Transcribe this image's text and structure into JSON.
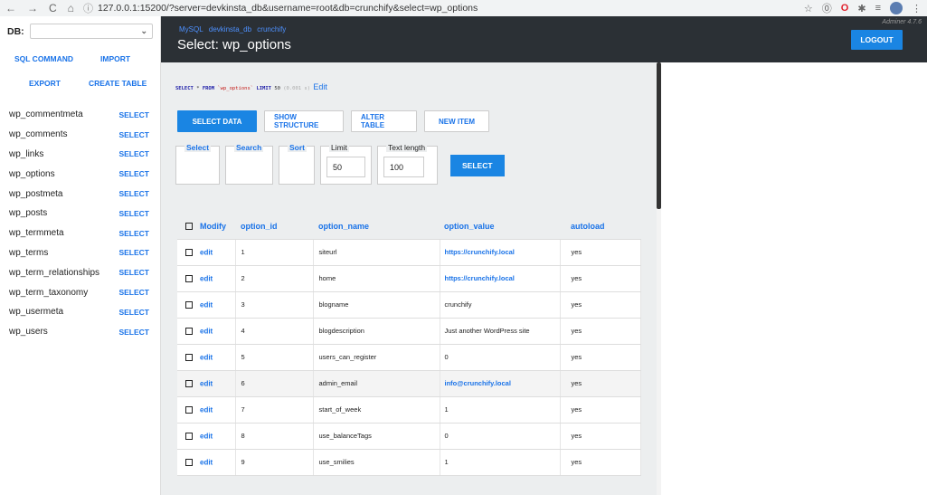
{
  "browser": {
    "url": "127.0.0.1:15200/?server=devkinsta_db&username=root&db=crunchify&select=wp_options"
  },
  "sidebar": {
    "db_label": "DB:",
    "db_value": "",
    "links": {
      "sql_command": "SQL COMMAND",
      "import": "IMPORT",
      "export": "EXPORT",
      "create_table": "CREATE TABLE"
    },
    "select_label": "SELECT",
    "tables": [
      "wp_commentmeta",
      "wp_comments",
      "wp_links",
      "wp_options",
      "wp_postmeta",
      "wp_posts",
      "wp_termmeta",
      "wp_terms",
      "wp_term_relationships",
      "wp_term_taxonomy",
      "wp_usermeta",
      "wp_users"
    ]
  },
  "header": {
    "breadcrumbs": [
      "MySQL",
      "devkinsta_db",
      "crunchify"
    ],
    "title": "Select: wp_options",
    "version": "Adminer 4.7.6",
    "logout": "LOGOUT"
  },
  "query": {
    "select_kw": "SELECT",
    "star": "*",
    "from_kw": "FROM",
    "table": "`wp_options`",
    "limit_kw": "LIMIT",
    "limit_val": "50",
    "time": "(0.001 s)",
    "edit": "Edit"
  },
  "actions": {
    "select_data": "SELECT DATA",
    "show_structure": "SHOW STRUCTURE",
    "alter_table": "ALTER TABLE",
    "new_item": "NEW ITEM"
  },
  "filters": {
    "select": "Select",
    "search": "Search",
    "sort": "Sort",
    "limit": "Limit",
    "limit_value": "50",
    "text_length": "Text length",
    "text_length_value": "100",
    "submit": "SELECT"
  },
  "table": {
    "headers": {
      "modify": "Modify",
      "option_id": "option_id",
      "option_name": "option_name",
      "option_value": "option_value",
      "autoload": "autoload"
    },
    "edit_label": "edit",
    "rows": [
      {
        "id": "1",
        "name": "siteurl",
        "value": "https://crunchify.local",
        "link": true,
        "autoload": "yes"
      },
      {
        "id": "2",
        "name": "home",
        "value": "https://crunchify.local",
        "link": true,
        "autoload": "yes"
      },
      {
        "id": "3",
        "name": "blogname",
        "value": "crunchify",
        "link": false,
        "autoload": "yes"
      },
      {
        "id": "4",
        "name": "blogdescription",
        "value": "Just another WordPress site",
        "link": false,
        "autoload": "yes"
      },
      {
        "id": "5",
        "name": "users_can_register",
        "value": "0",
        "link": false,
        "autoload": "yes"
      },
      {
        "id": "6",
        "name": "admin_email",
        "value": "info@crunchify.local",
        "link": true,
        "autoload": "yes"
      },
      {
        "id": "7",
        "name": "start_of_week",
        "value": "1",
        "link": false,
        "autoload": "yes"
      },
      {
        "id": "8",
        "name": "use_balanceTags",
        "value": "0",
        "link": false,
        "autoload": "yes"
      },
      {
        "id": "9",
        "name": "use_smilies",
        "value": "1",
        "link": false,
        "autoload": "yes"
      }
    ]
  }
}
